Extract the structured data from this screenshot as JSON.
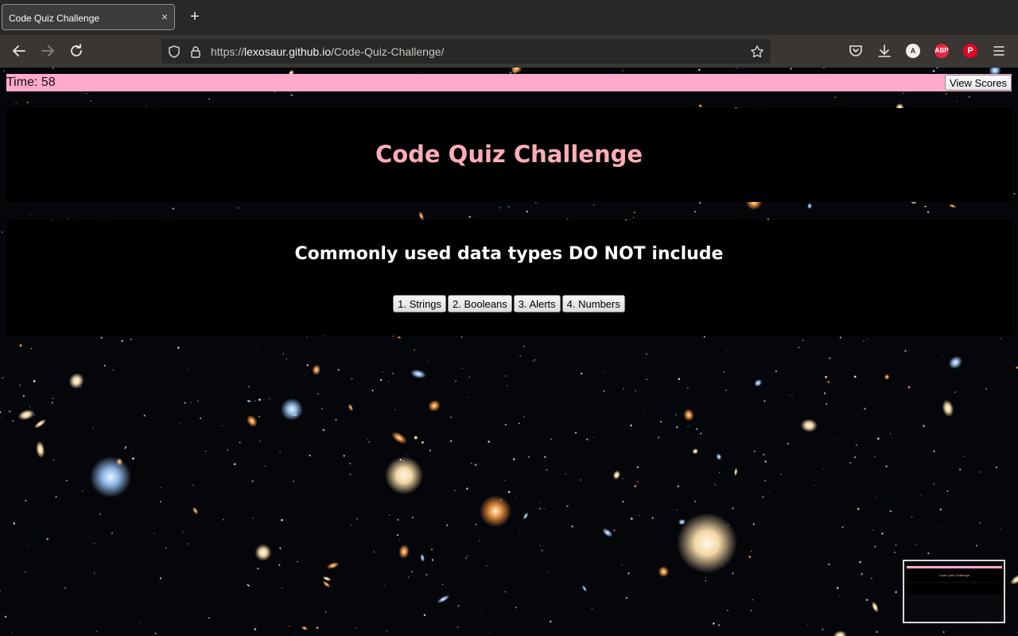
{
  "browser": {
    "tab_title": "Code Quiz Challenge",
    "tab_close_glyph": "×",
    "new_tab_glyph": "+",
    "url_scheme": "https://",
    "url_host": "lexosaur.github.io",
    "url_path": "/Code-Quiz-Challenge/",
    "toolbar_badges": {
      "account_letter": "A",
      "adblock_label": "ABP",
      "pinterest_letter": "P"
    }
  },
  "quiz": {
    "timer_text": "Time: 58",
    "view_scores_label": "View Scores",
    "title": "Code Quiz Challenge",
    "question": "Commonly used data types DO NOT include",
    "answers": [
      {
        "label": "1. Strings"
      },
      {
        "label": "2. Booleans"
      },
      {
        "label": "3. Alerts"
      },
      {
        "label": "4. Numbers"
      }
    ]
  },
  "minimap": {
    "title": "Code Quiz Challenge"
  },
  "colors": {
    "accent_pink": "#ffaacc",
    "title_pink": "#ffadb8",
    "panel_black": "#000000",
    "chrome_dark": "#2a2826",
    "toolbar": "#393634",
    "adblock_red": "#e8243f",
    "pinterest_red": "#e60023"
  },
  "icons": [
    "close-icon",
    "plus-icon",
    "back-arrow-icon",
    "forward-arrow-icon",
    "reload-icon",
    "shield-icon",
    "lock-icon",
    "star-icon",
    "pocket-icon",
    "download-icon",
    "account-icon",
    "adblock-icon",
    "pinterest-icon",
    "hamburger-menu-icon"
  ]
}
